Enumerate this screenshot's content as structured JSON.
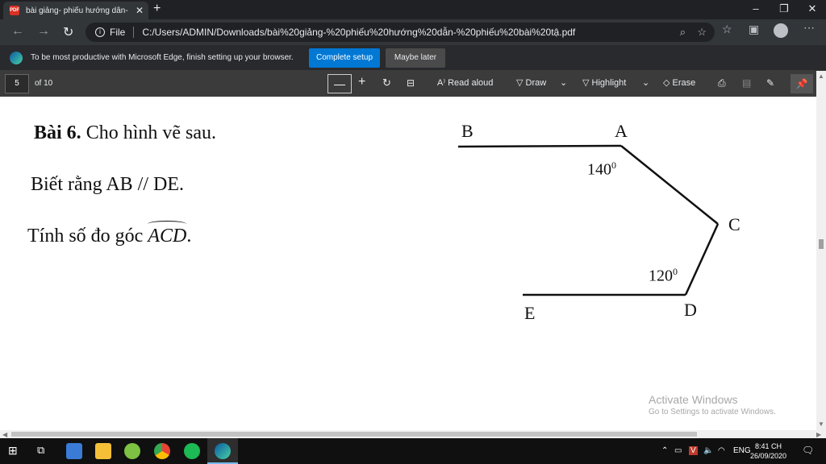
{
  "browser": {
    "tab_title": "bài giảng- phiếu hướng dẫn- ph",
    "url_label": "File",
    "url": "C:/Users/ADMIN/Downloads/bài%20giảng-%20phiếu%20hướng%20dẫn-%20phiếu%20bài%20tậ.pdf"
  },
  "infobar": {
    "message": "To be most productive with Microsoft Edge, finish setting up your browser.",
    "primary_label": "Complete setup",
    "secondary_label": "Maybe later"
  },
  "pdf_toolbar": {
    "page_number": "5",
    "page_total": "of 10",
    "read_aloud_label": "Read aloud",
    "draw_label": "Draw",
    "highlight_label": "Highlight",
    "erase_label": "Erase"
  },
  "document": {
    "title_bold": "Bài 6.",
    "title_rest": " Cho hình vẽ sau.",
    "line2": "Biết rằng AB // DE.",
    "line3_prefix": "Tính số đo góc ",
    "line3_angle": "ACD",
    "line3_suffix": ".",
    "figure": {
      "label_b": "B",
      "label_a": "A",
      "label_c": "C",
      "label_d": "D",
      "label_e": "E",
      "angle_a": "140",
      "angle_d": "120",
      "degree_mark": "0"
    }
  },
  "watermark": {
    "title": "Activate Windows",
    "subtitle": "Go to Settings to activate Windows."
  },
  "taskbar": {
    "language": "ENG",
    "time": "8:41 CH",
    "date": "26/09/2020"
  }
}
